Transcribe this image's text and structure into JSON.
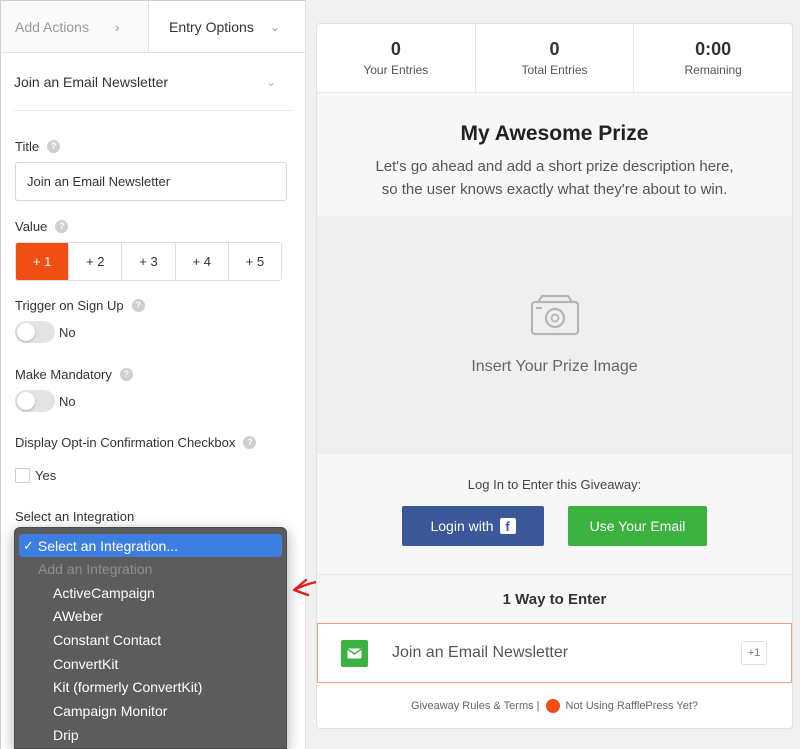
{
  "tabs": {
    "add_actions": "Add Actions",
    "entry_options": "Entry Options"
  },
  "section": {
    "title": "Join an Email Newsletter"
  },
  "form": {
    "title_label": "Title",
    "title_value": "Join an Email Newsletter",
    "value_label": "Value",
    "value_options": [
      "+ 1",
      "+ 2",
      "+ 3",
      "+ 4",
      "+ 5"
    ],
    "value_selected": "+ 1",
    "trigger_label": "Trigger on Sign Up",
    "trigger_state": "No",
    "mandatory_label": "Make Mandatory",
    "mandatory_state": "No",
    "optin_label": "Display Opt-in Confirmation Checkbox",
    "optin_checkbox_label": "Yes",
    "integration_label": "Select an Integration"
  },
  "dropdown": {
    "selected": "Select an Integration...",
    "group_label": "Add an Integration",
    "options": [
      "ActiveCampaign",
      "AWeber",
      "Constant Contact",
      "ConvertKit",
      "Kit (formerly ConvertKit)",
      "Campaign Monitor",
      "Drip"
    ]
  },
  "preview": {
    "stats": [
      {
        "value": "0",
        "label": "Your Entries"
      },
      {
        "value": "0",
        "label": "Total Entries"
      },
      {
        "value": "0:00",
        "label": "Remaining"
      }
    ],
    "prize_title": "My Awesome Prize",
    "prize_desc_line1": "Let's go ahead and add a short prize description here,",
    "prize_desc_line2": "so the user knows exactly what they're about to win.",
    "image_caption": "Insert Your Prize Image",
    "login_text": "Log In to Enter this Giveaway:",
    "login_fb": "Login with",
    "login_email": "Use Your Email",
    "ways_title": "1 Way to Enter",
    "entry_text": "Join an Email Newsletter",
    "entry_badge": "+1",
    "footer_rules": "Giveaway Rules & Terms |",
    "footer_promo": "Not Using RafflePress Yet?"
  },
  "colors": {
    "accent": "#f04e12",
    "facebook": "#3b5998",
    "email_green": "#3bb13f",
    "dropdown_highlight": "#3d7fe0"
  }
}
